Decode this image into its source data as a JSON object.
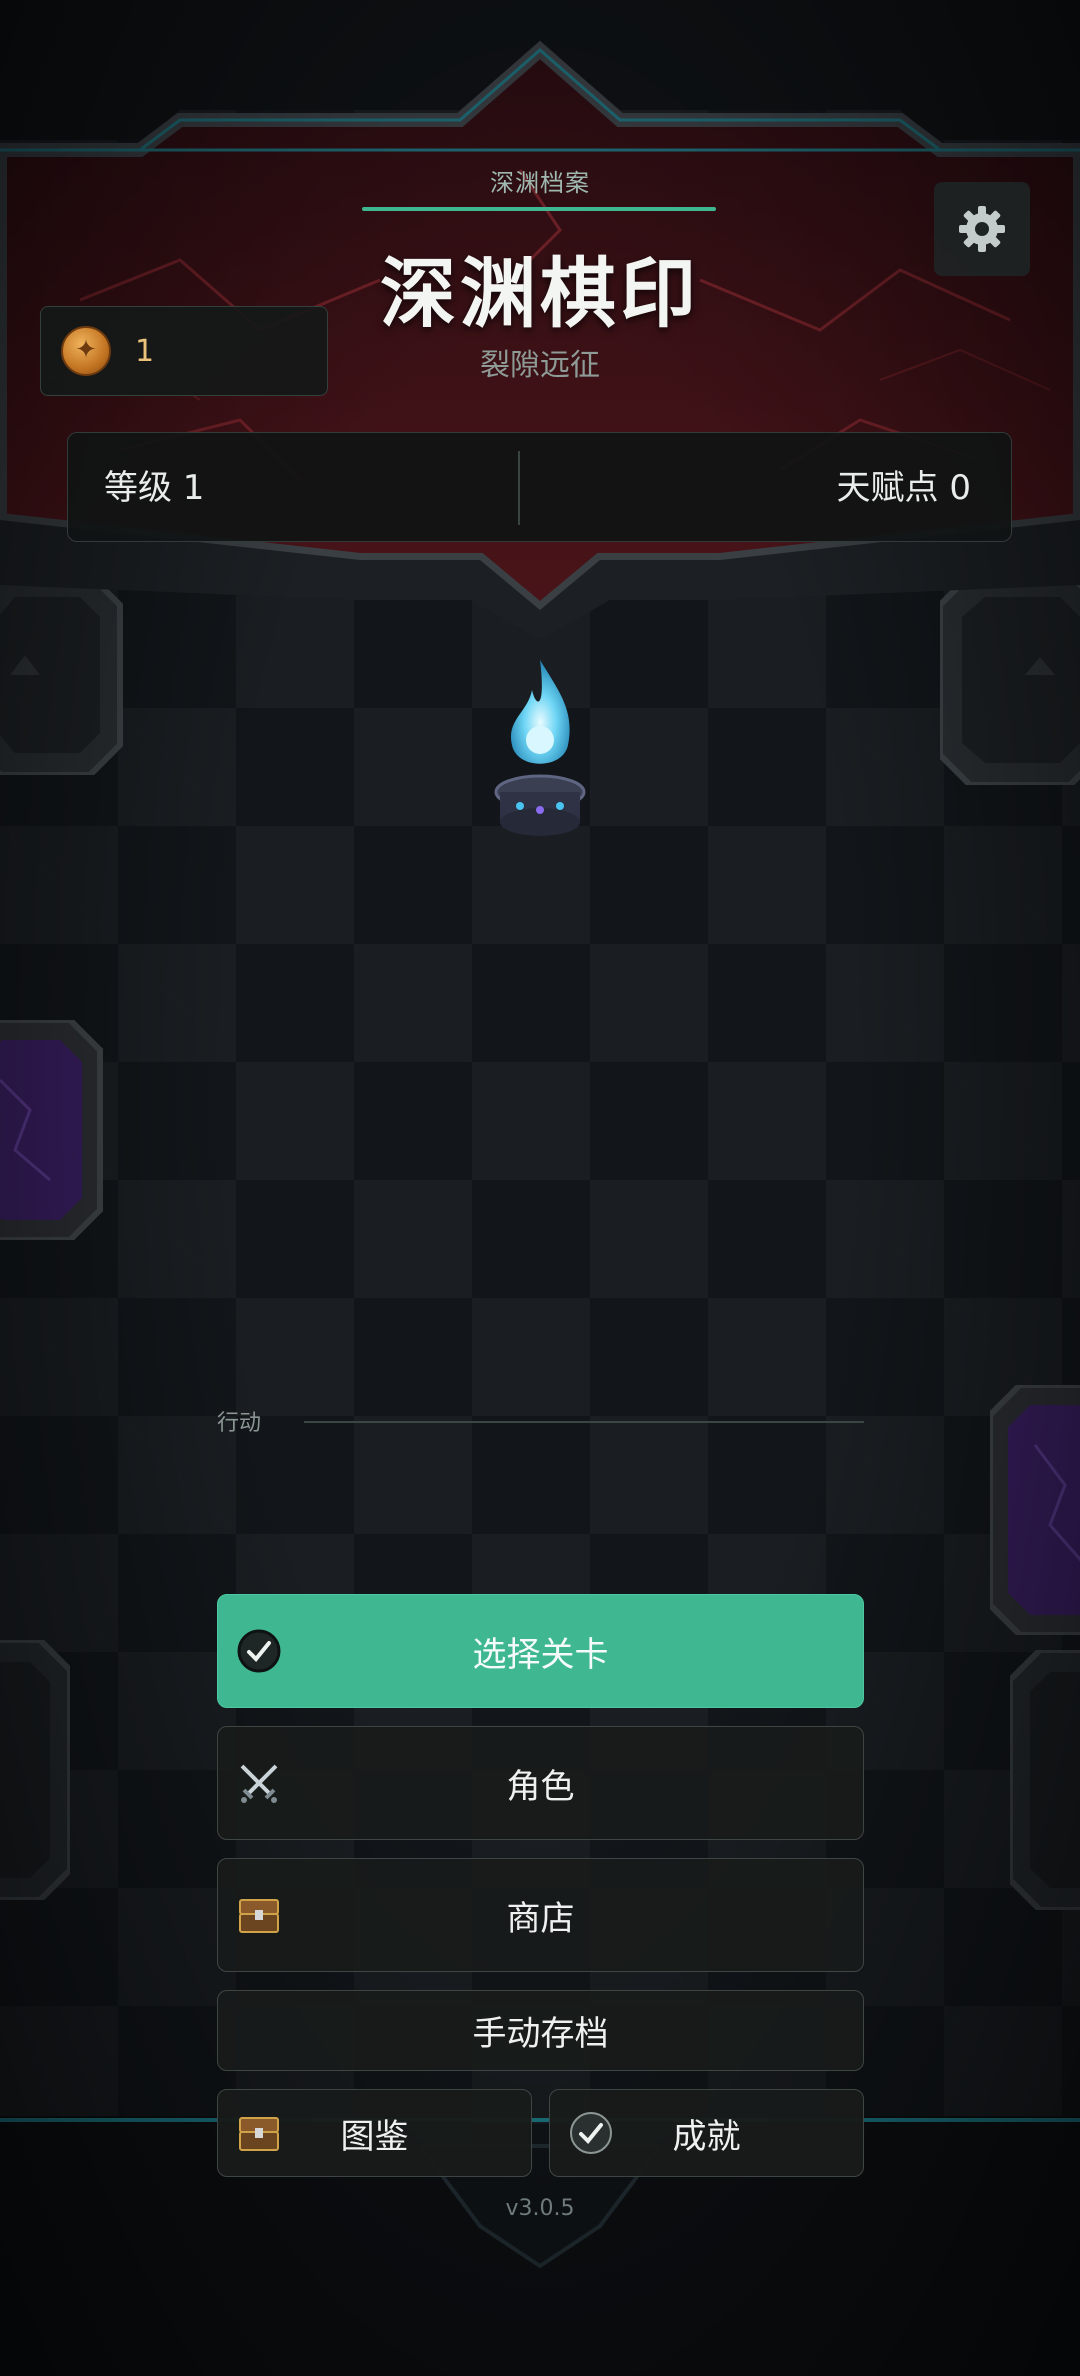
{
  "header": {
    "archive_label": "深渊档案",
    "title": "深渊棋印",
    "subtitle": "裂隙远征"
  },
  "resources": {
    "coin_icon": "rune-coin-icon",
    "coin_count": "1"
  },
  "stats": {
    "level_label": "等级 1",
    "talent_label": "天赋点 0"
  },
  "settings": {
    "icon": "gear-icon"
  },
  "actions": {
    "section_label": "行动",
    "select_stage": "选择关卡",
    "character": "角色",
    "shop": "商店",
    "manual_save": "手动存档",
    "codex": "图鉴",
    "achievements": "成就"
  },
  "footer": {
    "version": "v3.0.5"
  },
  "colors": {
    "accent": "#3fb891",
    "banner_red": "#5a1a1e",
    "background": "#12161a",
    "coin": "#e9c27b"
  }
}
